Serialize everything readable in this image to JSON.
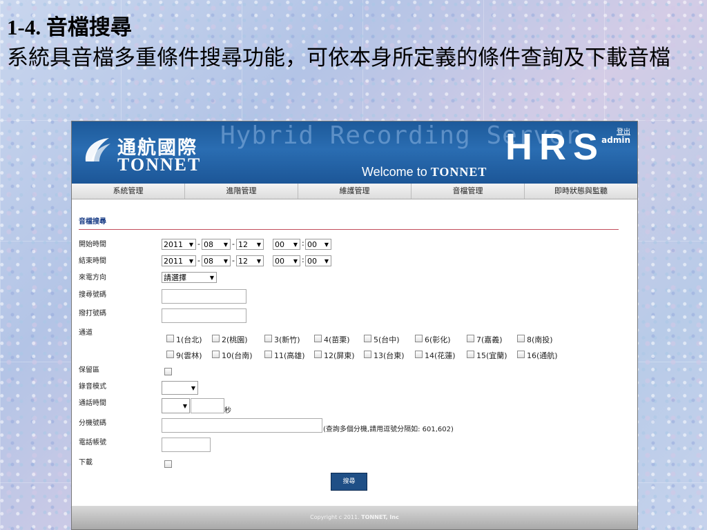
{
  "slide": {
    "title": "1-4. 音檔搜尋",
    "description": "系統具音檔多重條件搜尋功能，可依本身所定義的條件查詢及下載音檔"
  },
  "header": {
    "brand_zh": "通航國際",
    "brand_en": "TONNET",
    "product": "Hybrid Recording Server",
    "welcome_text": "Welcome to",
    "welcome_brand": "TONNET",
    "logo_letters": "HRS",
    "logout": "登出",
    "user": "admin"
  },
  "nav": [
    "系統管理",
    "進階管理",
    "維護管理",
    "音檔管理",
    "即時狀態與監聽"
  ],
  "search_form": {
    "section_title": "音檔搜尋",
    "start_time": {
      "label": "開始時間",
      "year": "2011",
      "month": "08",
      "day": "12",
      "hour": "00",
      "minute": "00"
    },
    "end_time": {
      "label": "結束時間",
      "year": "2011",
      "month": "08",
      "day": "12",
      "hour": "00",
      "minute": "00"
    },
    "direction": {
      "label": "來電方向",
      "value": "請選擇"
    },
    "search_number": {
      "label": "搜尋號碼",
      "value": ""
    },
    "dial_number": {
      "label": "撥打號碼",
      "value": ""
    },
    "channel": {
      "label": "通道",
      "options": [
        "1(台北)",
        "2(桃園)",
        "3(新竹)",
        "4(苗栗)",
        "5(台中)",
        "6(彰化)",
        "7(嘉義)",
        "8(南投)",
        "9(雲林)",
        "10(台南)",
        "11(高雄)",
        "12(屏東)",
        "13(台東)",
        "14(花蓮)",
        "15(宜蘭)",
        "16(通航)"
      ]
    },
    "reserve": {
      "label": "保留區"
    },
    "record_mode": {
      "label": "錄音模式",
      "value": ""
    },
    "call_duration": {
      "label": "通話時間",
      "value": "",
      "unit": "秒"
    },
    "extension": {
      "label": "分機號碼",
      "value": "",
      "hint": "(查詢多個分機,請用逗號分隔如: 601,602)"
    },
    "phone_account": {
      "label": "電話帳號",
      "value": ""
    },
    "download": {
      "label": "下載"
    },
    "search_button": "搜尋"
  },
  "footer": {
    "text": "Copyright c 2011.",
    "company": "TONNET, Inc"
  },
  "colors": {
    "header_blue": "#2a6db2",
    "button_blue": "#1f4f86",
    "rule_red": "#c24b5a",
    "title_blue": "#173b85"
  }
}
